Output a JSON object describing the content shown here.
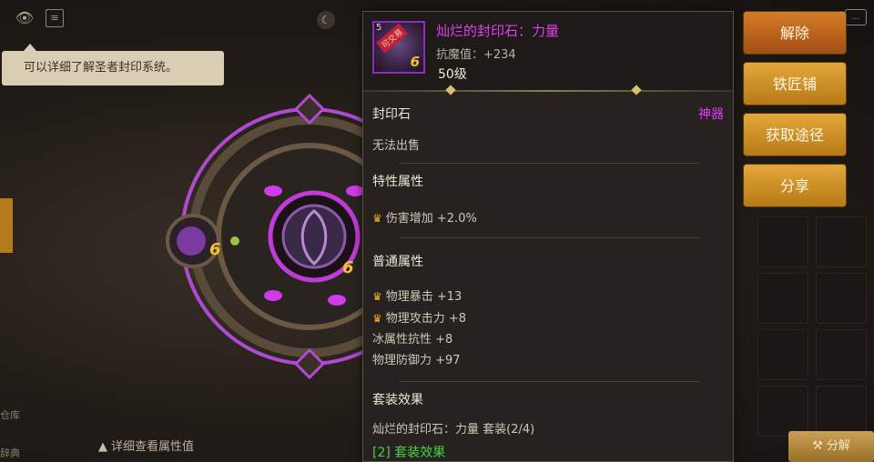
{
  "background": {
    "tooltip_bubble": "可以详细了解圣者封印系统。",
    "detail_link": "详细查看属性值",
    "left_labels": [
      "仓库",
      "辞典"
    ],
    "decompose_button": "分解",
    "seal_center_stack": "6",
    "seal_side_stack": "6"
  },
  "item": {
    "name": "灿烂的封印石：力量",
    "stat_line": "抗魔值：+234",
    "level": "50级",
    "icon_level": "5",
    "icon_badge": "可交易",
    "icon_stack": "6"
  },
  "panel": {
    "type_label": "封印石",
    "rarity": "神器",
    "sell_note": "无法出售",
    "special_title": "特性属性",
    "special_attrs": [
      "伤害增加 +2.0%"
    ],
    "common_title": "普通属性",
    "common_attrs_crowned": [
      "物理暴击 +13",
      "物理攻击力 +8"
    ],
    "common_attrs_plain": [
      "冰属性抗性 +8",
      "物理防御力 +97"
    ],
    "set_title": "套装效果",
    "set_name": "灿烂的封印石：力量 套装(2/4)",
    "set_effect": "[2] 套装效果"
  },
  "actions": {
    "unequip": "解除",
    "blacksmith": "铁匠铺",
    "acquire": "获取途径",
    "share": "分享"
  },
  "colors": {
    "rarity": "#e23ef2",
    "set_bonus": "#47d147",
    "crown": "#e8b420",
    "button_red": "#c2641e",
    "button_gold": "#d4952c"
  }
}
